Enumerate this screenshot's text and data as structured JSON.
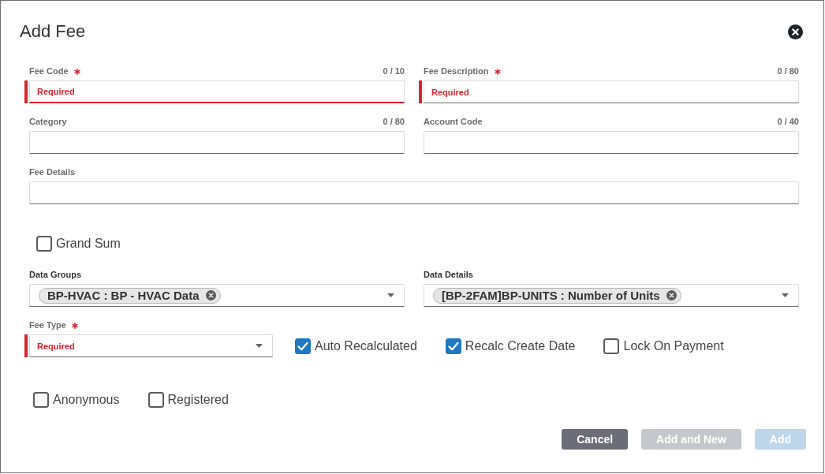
{
  "dialog": {
    "title": "Add Fee"
  },
  "field_rows": [
    {
      "fields": [
        {
          "label": "Fee Code",
          "required": true,
          "counter": "0 / 10",
          "placeholder": "Required",
          "invalid": true,
          "focused": true
        },
        {
          "label": "Fee Description",
          "required": true,
          "counter": "0 / 80",
          "placeholder": "Required",
          "invalid": true,
          "focused": false
        }
      ]
    },
    {
      "fields": [
        {
          "label": "Category",
          "required": false,
          "counter": "0 / 80",
          "invalid": false,
          "focused": false
        },
        {
          "label": "Account Code",
          "required": false,
          "counter": "0 / 40",
          "invalid": false,
          "focused": false
        }
      ]
    },
    {
      "fields": [
        {
          "label": "Fee Details",
          "required": false,
          "invalid": false,
          "focused": false
        }
      ]
    }
  ],
  "grand_sum": {
    "label": "Grand Sum",
    "checked": false
  },
  "multi_selects": [
    {
      "label": "Data Groups",
      "chips": [
        "BP-HVAC : BP - HVAC Data"
      ]
    },
    {
      "label": "Data Details",
      "chips": [
        "[BP-2FAM]BP-UNITS : Number of Units"
      ]
    }
  ],
  "fee_type": {
    "label": "Fee Type",
    "required": true,
    "placeholder": "Required",
    "invalid": true
  },
  "recalc_options": [
    {
      "label": "Auto Recalculated",
      "checked": true
    },
    {
      "label": "Recalc Create Date",
      "checked": true
    },
    {
      "label": "Lock On Payment",
      "checked": false
    }
  ],
  "customer_options": [
    {
      "label": "Anonymous",
      "checked": false
    },
    {
      "label": "Registered",
      "checked": false
    }
  ],
  "buttons": [
    {
      "label": "Cancel",
      "kind": "secondary",
      "disabled": false
    },
    {
      "label": "Add and New",
      "kind": "secondary",
      "disabled": true
    },
    {
      "label": "Add",
      "kind": "primary",
      "disabled": true
    }
  ]
}
